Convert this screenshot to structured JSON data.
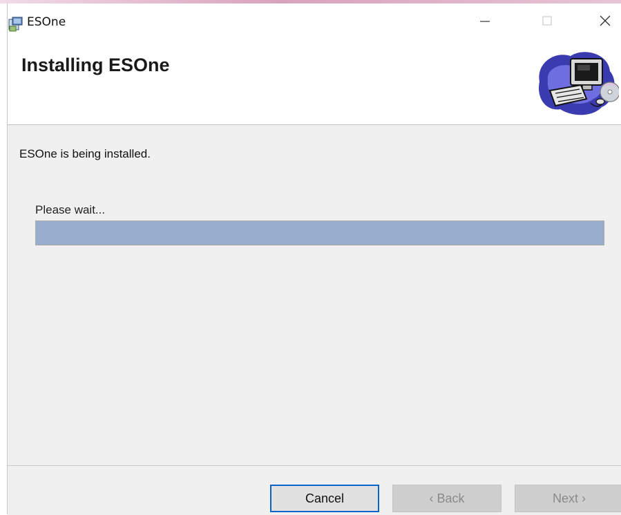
{
  "window": {
    "title": "ESOne",
    "controls": {
      "minimize_icon": "minimize-icon",
      "maximize_icon": "maximize-icon",
      "close_icon": "close-icon"
    }
  },
  "header": {
    "title": "Installing ESOne",
    "graphic_icon": "computer-install-icon"
  },
  "content": {
    "status": "ESOne is being installed.",
    "wait_label": "Please wait...",
    "progress": 1.0
  },
  "buttons": {
    "cancel": "Cancel",
    "back": "‹ Back",
    "next": "Next ›"
  },
  "colors": {
    "progress_fill": "#96aecc",
    "focus_border": "#0a64c8"
  }
}
